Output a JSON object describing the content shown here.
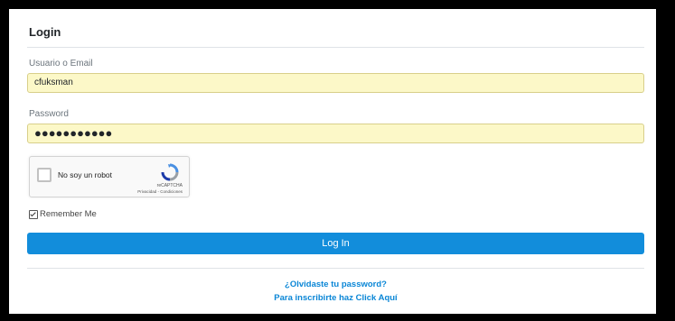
{
  "header": {
    "title": "Login"
  },
  "form": {
    "username_label": "Usuario o Email",
    "username_value": "cfuksman",
    "password_label": "Password",
    "password_value": "●●●●●●●●●●●",
    "captcha_label": "No soy un robot",
    "captcha_brand": "reCAPTCHA",
    "captcha_links": "Privacidad - Condiciones",
    "remember_label": "Remember Me",
    "login_button": "Log In"
  },
  "links": {
    "forgot_password": "¿Olvidaste tu password?",
    "register": "Para inscribirte haz Click Aquí"
  },
  "colors": {
    "primary": "#128ddb",
    "link": "#0a86d6",
    "autofill": "#fcf8c8"
  }
}
